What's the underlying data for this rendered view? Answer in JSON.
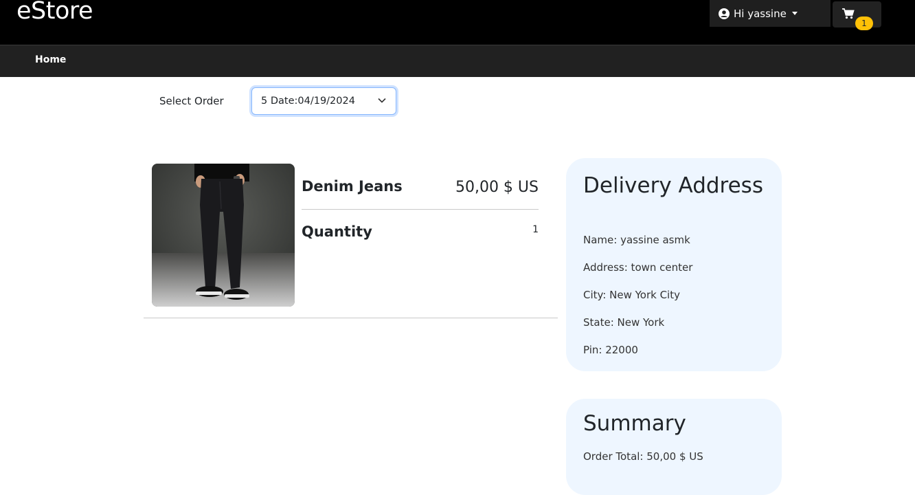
{
  "header": {
    "brand": "eStore",
    "user_greeting": "Hi yassine",
    "cart_count": "1"
  },
  "nav": {
    "home": "Home"
  },
  "order_selector": {
    "label": "Select Order",
    "selected": "5 Date:04/19/2024"
  },
  "order_item": {
    "name": "Denim Jeans",
    "price": "50,00 $ US",
    "quantity_label": "Quantity",
    "quantity": "1"
  },
  "delivery": {
    "title": "Delivery Address",
    "name": "Name: yassine asmk",
    "address": "Address: town center",
    "city": "City: New York City",
    "state": "State: New York",
    "pin": "Pin: 22000"
  },
  "summary": {
    "title": "Summary",
    "order_total": "Order Total: 50,00 $ US"
  },
  "icons": {
    "user": "user-circle-icon",
    "cart": "shopping-cart-icon",
    "select": "chevron-down-icon"
  },
  "colors": {
    "topbar": "#000000",
    "navbar": "#212121",
    "badge": "#ffc107",
    "card": "#eef6ff"
  }
}
